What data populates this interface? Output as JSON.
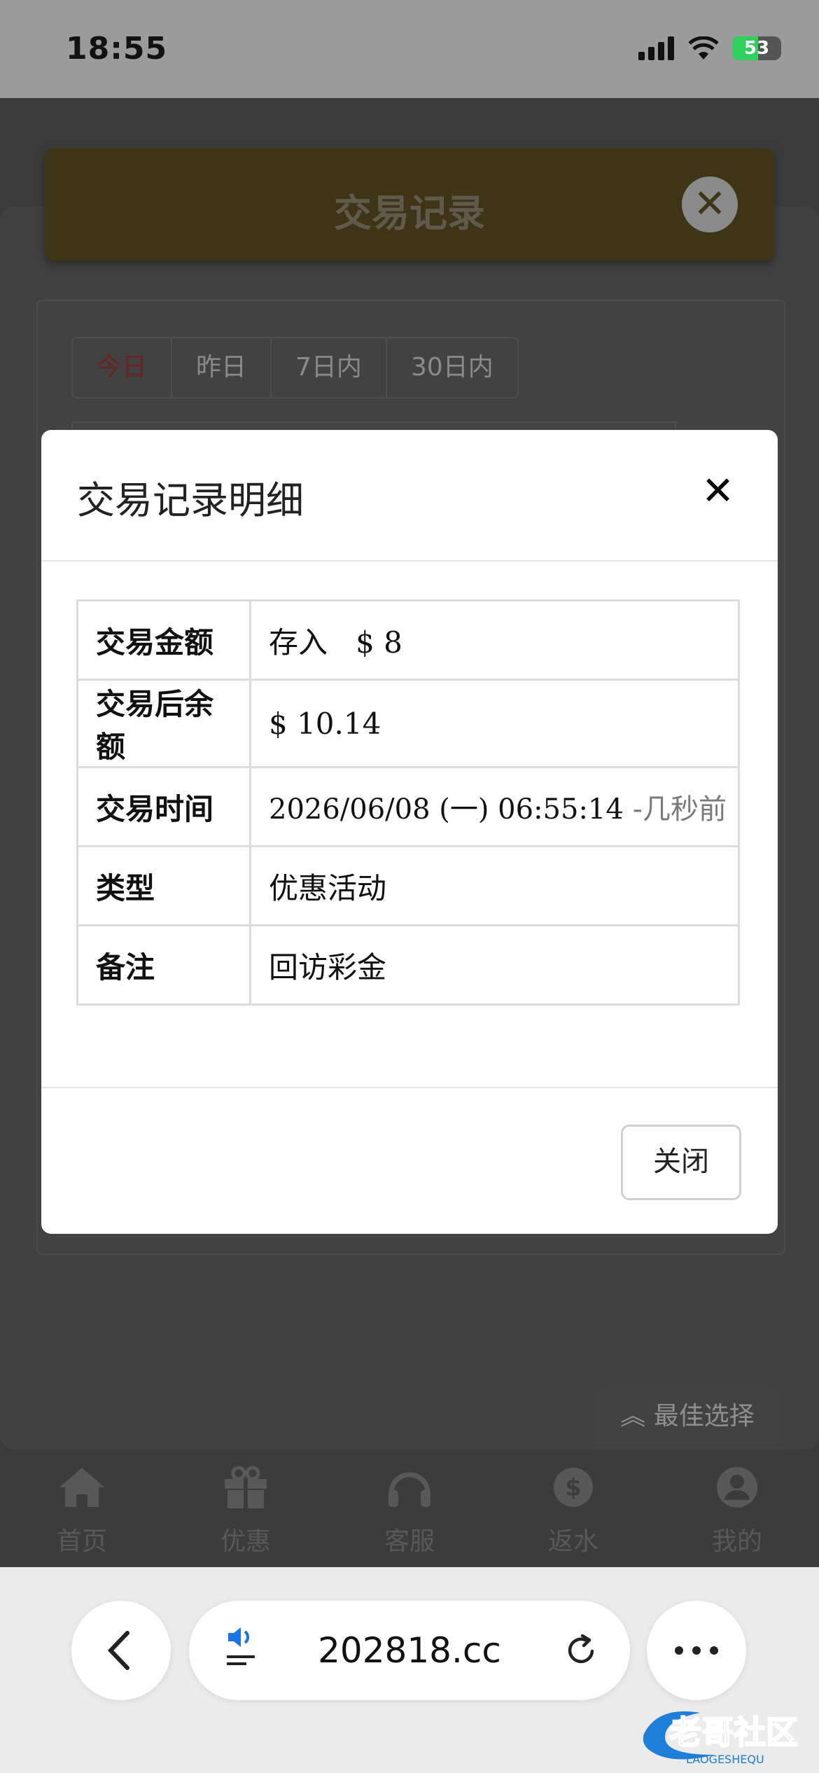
{
  "status_bar": {
    "time": "18:55",
    "battery": "53",
    "battery_level": 0.53
  },
  "header": {
    "title": "交易记录"
  },
  "date_tabs": [
    "今日",
    "昨日",
    "7日内",
    "30日内"
  ],
  "modal": {
    "title": "交易记录明细",
    "rows": [
      {
        "label": "交易金额",
        "value_prefix": "存入",
        "value": "$ 8"
      },
      {
        "label": "交易后余额",
        "value": "$ 10.14"
      },
      {
        "label": "交易时间",
        "value": "2026/06/08 (一) 06:55:14",
        "value_suffix": "-几秒前"
      },
      {
        "label": "类型",
        "value": "优惠活动"
      },
      {
        "label": "备注",
        "value": "回访彩金"
      }
    ],
    "close_button": "关闭"
  },
  "best_choice": "最佳选择",
  "bottom_nav": [
    {
      "label": "首页",
      "icon": "home-icon"
    },
    {
      "label": "优惠",
      "icon": "gift-icon"
    },
    {
      "label": "客服",
      "icon": "headset-icon"
    },
    {
      "label": "返水",
      "icon": "dollar-badge-icon"
    },
    {
      "label": "我的",
      "icon": "user-icon"
    }
  ],
  "browser": {
    "url": "202818.cc"
  },
  "watermark": {
    "text": "老哥社区",
    "subtext": "LAOGESHEQU"
  },
  "colors": {
    "amount_green": "#2f7d32",
    "header_dim": "#3e3416",
    "active_tab": "#6a2222"
  }
}
